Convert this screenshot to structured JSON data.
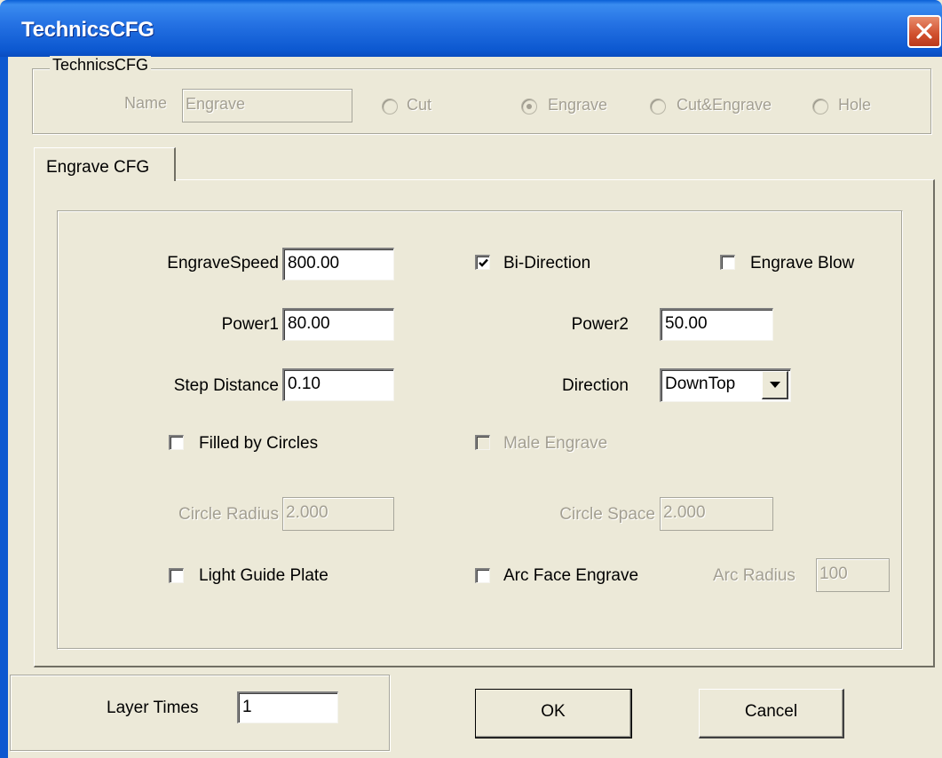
{
  "window": {
    "title": "TechnicsCFG"
  },
  "group": {
    "title": "TechnicsCFG",
    "name_label": "Name",
    "name_value": "Engrave",
    "radios": [
      {
        "label": "Cut",
        "selected": false
      },
      {
        "label": "Engrave",
        "selected": true
      },
      {
        "label": "Cut&Engrave",
        "selected": false
      },
      {
        "label": "Hole",
        "selected": false
      }
    ]
  },
  "tabs": [
    {
      "label": "Engrave CFG"
    }
  ],
  "engrave": {
    "engrave_speed_label": "EngraveSpeed",
    "engrave_speed_value": "800.00",
    "bi_direction_label": "Bi-Direction",
    "bi_direction_checked": true,
    "engrave_blow_label": "Engrave Blow",
    "engrave_blow_checked": false,
    "power1_label": "Power1",
    "power1_value": "80.00",
    "power2_label": "Power2",
    "power2_value": "50.00",
    "step_distance_label": "Step Distance",
    "step_distance_value": "0.10",
    "direction_label": "Direction",
    "direction_value": "DownTop",
    "filled_by_circles_label": "Filled by Circles",
    "filled_by_circles_checked": false,
    "male_engrave_label": "Male Engrave",
    "male_engrave_checked": false,
    "circle_radius_label": "Circle Radius",
    "circle_radius_value": "2.000",
    "circle_space_label": "Circle Space",
    "circle_space_value": "2.000",
    "light_guide_plate_label": "Light Guide Plate",
    "light_guide_plate_checked": false,
    "arc_face_engrave_label": "Arc Face Engrave",
    "arc_face_engrave_checked": false,
    "arc_radius_label": "Arc Radius",
    "arc_radius_value": "100"
  },
  "bottom": {
    "layer_times_label": "Layer Times",
    "layer_times_value": "1",
    "ok_label": "OK",
    "cancel_label": "Cancel"
  },
  "colors": {
    "title_bar": "#0c58d0",
    "dialog_bg": "#ece9d8",
    "close_button": "#d0502e",
    "disabled_text": "#a39f92"
  },
  "icons": [
    "close-icon",
    "checkmark-icon",
    "chevron-down-icon"
  ]
}
